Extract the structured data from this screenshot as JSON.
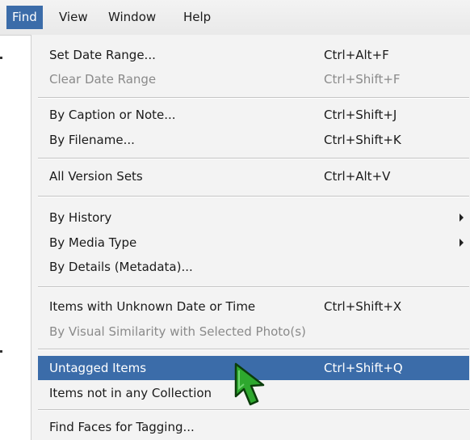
{
  "menubar": {
    "items": [
      {
        "label": "Find"
      },
      {
        "label": "View"
      },
      {
        "label": "Window"
      },
      {
        "label": "Help"
      }
    ]
  },
  "find_menu": {
    "items": [
      {
        "label": "Set Date Range...",
        "shortcut": "Ctrl+Alt+F",
        "enabled": true
      },
      {
        "label": "Clear Date Range",
        "shortcut": "Ctrl+Shift+F",
        "enabled": false
      },
      {
        "label": "By Caption or Note...",
        "shortcut": "Ctrl+Shift+J",
        "enabled": true
      },
      {
        "label": "By Filename...",
        "shortcut": "Ctrl+Shift+K",
        "enabled": true
      },
      {
        "label": "All Version Sets",
        "shortcut": "Ctrl+Alt+V",
        "enabled": true
      },
      {
        "label": "By History",
        "shortcut": "",
        "enabled": true,
        "submenu": true
      },
      {
        "label": "By Media Type",
        "shortcut": "",
        "enabled": true,
        "submenu": true
      },
      {
        "label": "By Details (Metadata)...",
        "shortcut": "",
        "enabled": true
      },
      {
        "label": "Items with Unknown Date or Time",
        "shortcut": "Ctrl+Shift+X",
        "enabled": true
      },
      {
        "label": "By Visual Similarity with Selected Photo(s)",
        "shortcut": "",
        "enabled": false
      },
      {
        "label": "Untagged Items",
        "shortcut": "Ctrl+Shift+Q",
        "enabled": true,
        "highlighted": true
      },
      {
        "label": "Items not in any Collection",
        "shortcut": "",
        "enabled": true
      },
      {
        "label": "Find Faces for Tagging...",
        "shortcut": "",
        "enabled": true
      }
    ]
  },
  "cursor": {
    "icon": "arrow-cursor-icon",
    "color": "#2ea82e"
  },
  "colors": {
    "highlight": "#3b6ca9",
    "menu_bg": "#f3f3f3",
    "disabled_text": "#8a8a8a"
  }
}
